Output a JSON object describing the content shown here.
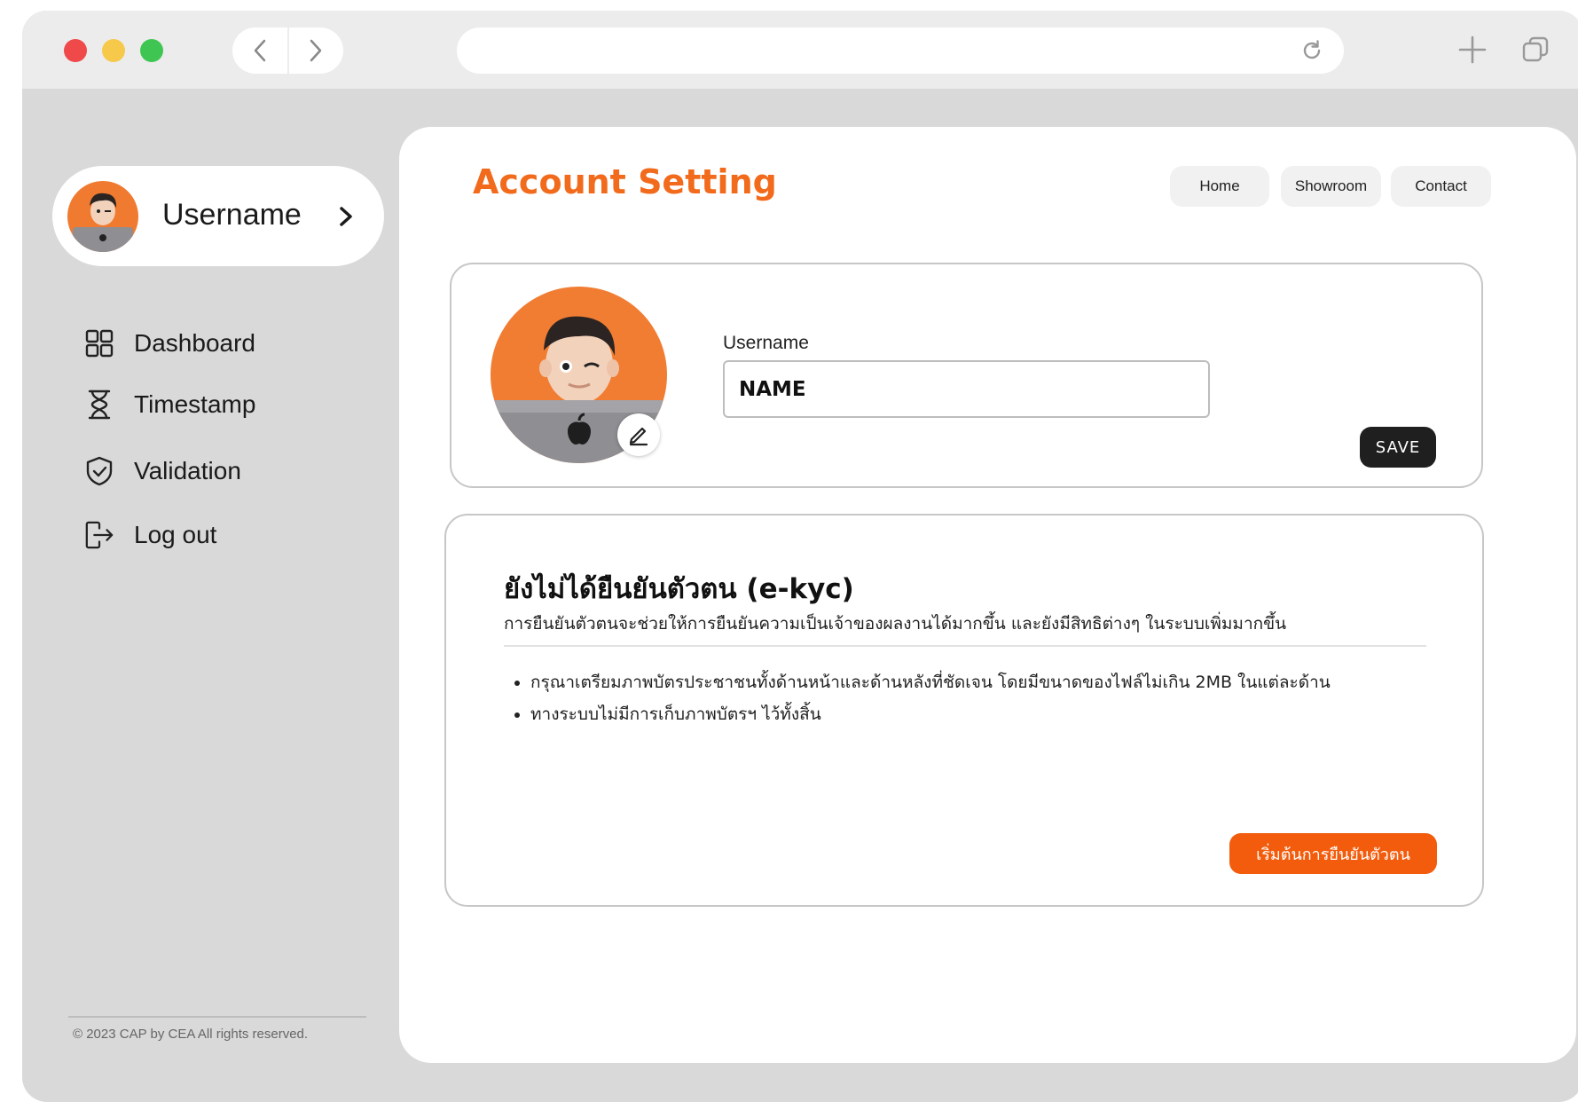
{
  "sidebar": {
    "profile_name": "Username",
    "items": [
      {
        "label": "Dashboard",
        "icon": "grid-icon"
      },
      {
        "label": "Timestamp",
        "icon": "hourglass-icon"
      },
      {
        "label": "Validation",
        "icon": "shield-check-icon"
      },
      {
        "label": "Log out",
        "icon": "logout-icon"
      }
    ],
    "footer": "© 2023 CAP by CEA All rights reserved."
  },
  "header": {
    "title": "Account Setting",
    "nav": [
      "Home",
      "Showroom",
      "Contact"
    ]
  },
  "profile_card": {
    "field_label": "Username",
    "username_value": "NAME",
    "save_label": "SAVE"
  },
  "kyc_card": {
    "title": "ยังไม่ได้ยืนยันตัวตน (e-kyc)",
    "description": "การยืนยันตัวตนจะช่วยให้การยืนยันความเป็นเจ้าของผลงานได้มากขึ้น และยังมีสิทธิต่างๆ ในระบบเพิ่มมากขึ้น",
    "bullets": [
      "กรุณาเตรียมภาพบัตรประชาชนทั้งด้านหน้าและด้านหลังที่ชัดเจน โดยมีขนาดของไฟล์ไม่เกิน 2MB ในแต่ละด้าน",
      "ทางระบบไม่มีการเก็บภาพบัตรฯ ไว้ทั้งสิ้น"
    ],
    "button_label": "เริ่มต้นการยืนยันตัวตน"
  },
  "colors": {
    "accent": "#f26a1b",
    "kyc_button": "#f25c0c",
    "save_button": "#1f1f1f",
    "background": "#d9d9d9"
  }
}
